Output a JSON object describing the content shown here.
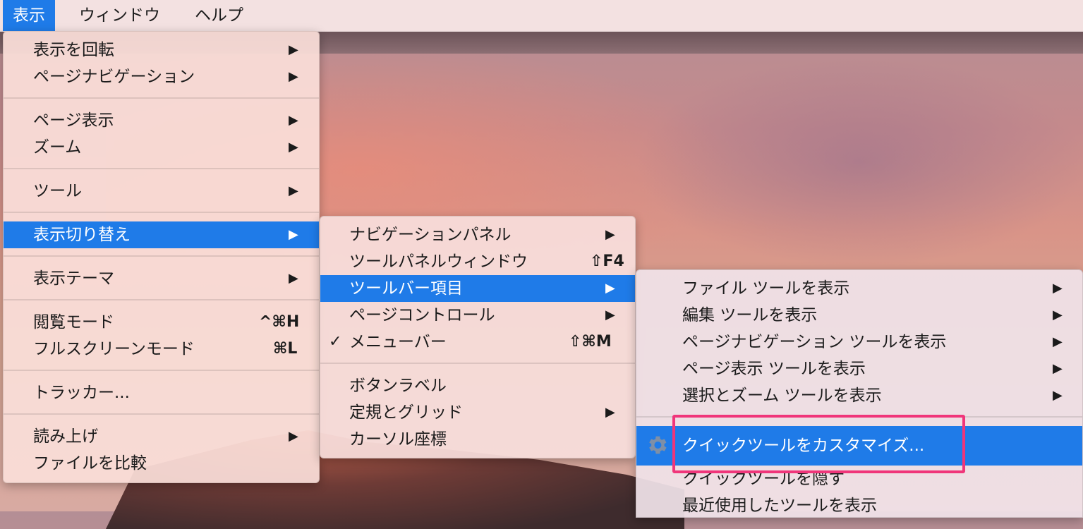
{
  "menubar": {
    "items": [
      "表示",
      "ウィンドウ",
      "ヘルプ"
    ]
  },
  "menu1": {
    "items": [
      {
        "label": "表示を回転",
        "submenu": true
      },
      {
        "label": "ページナビゲーション",
        "submenu": true
      },
      {
        "label": "ページ表示",
        "submenu": true
      },
      {
        "label": "ズーム",
        "submenu": true
      },
      {
        "label": "ツール",
        "submenu": true
      },
      {
        "label": "表示切り替え",
        "submenu": true,
        "highlighted": true
      },
      {
        "label": "表示テーマ",
        "submenu": true
      },
      {
        "label": "閲覧モード",
        "shortcut": "^⌘H"
      },
      {
        "label": "フルスクリーンモード",
        "shortcut": "⌘L"
      },
      {
        "label": "トラッカー..."
      },
      {
        "label": "読み上げ",
        "submenu": true
      },
      {
        "label": "ファイルを比較"
      }
    ]
  },
  "menu2": {
    "items": [
      {
        "label": "ナビゲーションパネル",
        "submenu": true
      },
      {
        "label": "ツールパネルウィンドウ",
        "shortcut": "⇧F4"
      },
      {
        "label": "ツールバー項目",
        "submenu": true,
        "highlighted": true
      },
      {
        "label": "ページコントロール",
        "submenu": true
      },
      {
        "label": "メニューバー",
        "shortcut": "⇧⌘M",
        "checked": true
      },
      {
        "label": "ボタンラベル"
      },
      {
        "label": "定規とグリッド",
        "submenu": true
      },
      {
        "label": "カーソル座標"
      }
    ],
    "check_mark": "✓"
  },
  "menu3": {
    "items": [
      {
        "label": "ファイル ツールを表示",
        "submenu": true
      },
      {
        "label": "編集 ツールを表示",
        "submenu": true
      },
      {
        "label": "ページナビゲーション ツールを表示",
        "submenu": true
      },
      {
        "label": "ページ表示 ツールを表示",
        "submenu": true
      },
      {
        "label": "選択とズーム ツールを表示",
        "submenu": true
      },
      {
        "label": "クイックツールをカスタマイズ...",
        "highlighted": true,
        "icon": "gear-icon"
      },
      {
        "label": "クイックツールを隠す"
      },
      {
        "label": "最近使用したツールを表示"
      }
    ]
  },
  "arrow_glyph": "▶",
  "colors": {
    "highlight": "#1f7be8",
    "annotation_box": "#f0357a"
  }
}
